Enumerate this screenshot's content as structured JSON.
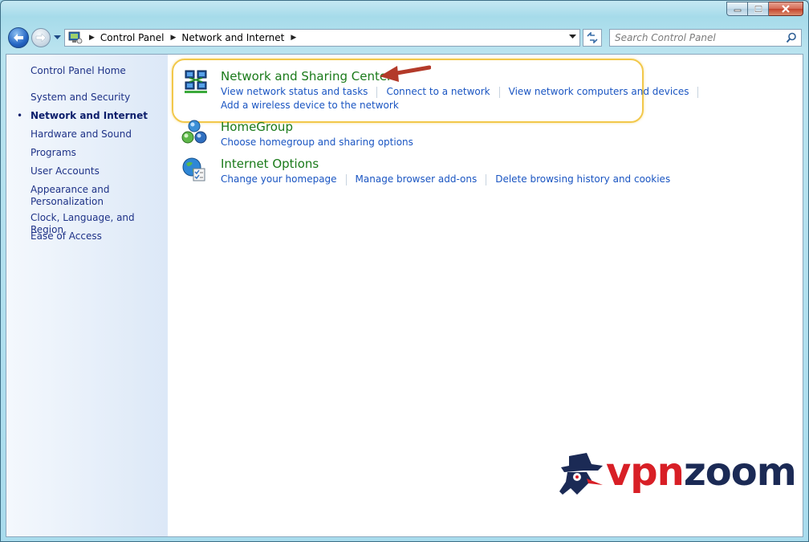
{
  "window": {
    "caption_buttons": {
      "minimize": "minimize",
      "maximize": "maximize",
      "close": "close"
    }
  },
  "navigation": {
    "breadcrumbs": [
      "Control Panel",
      "Network and Internet"
    ],
    "search_placeholder": "Search Control Panel"
  },
  "sidebar": {
    "home": "Control Panel Home",
    "items": [
      {
        "label": "System and Security",
        "current": false
      },
      {
        "label": "Network and Internet",
        "current": true
      },
      {
        "label": "Hardware and Sound",
        "current": false
      },
      {
        "label": "Programs",
        "current": false
      },
      {
        "label": "User Accounts",
        "current": false
      },
      {
        "label": "Appearance and\nPersonalization",
        "current": false
      },
      {
        "label": "Clock, Language, and Region",
        "current": false
      },
      {
        "label": "Ease of Access",
        "current": false
      }
    ],
    "current_marker": "•"
  },
  "tasks": [
    {
      "title": "Network and Sharing Center",
      "icon": "network-sharing-icon",
      "links": [
        "View network status and tasks",
        "Connect to a network",
        "View network computers and devices"
      ],
      "links_line2": "Add a wireless device to the network"
    },
    {
      "title": "HomeGroup",
      "icon": "homegroup-icon",
      "links": [
        "Choose homegroup and sharing options"
      ]
    },
    {
      "title": "Internet Options",
      "icon": "internet-options-icon",
      "links": [
        "Change your homepage",
        "Manage browser add-ons",
        "Delete browsing history and cookies"
      ]
    }
  ],
  "watermark": {
    "part1": "vpn",
    "part2": "zoom"
  },
  "colors": {
    "task_title": "#1a7a1a",
    "link": "#1a55c2",
    "highlight": "#f2c84b",
    "arrow": "#b33a2a",
    "logo_red": "#d81f26",
    "logo_navy": "#1b2a55"
  }
}
